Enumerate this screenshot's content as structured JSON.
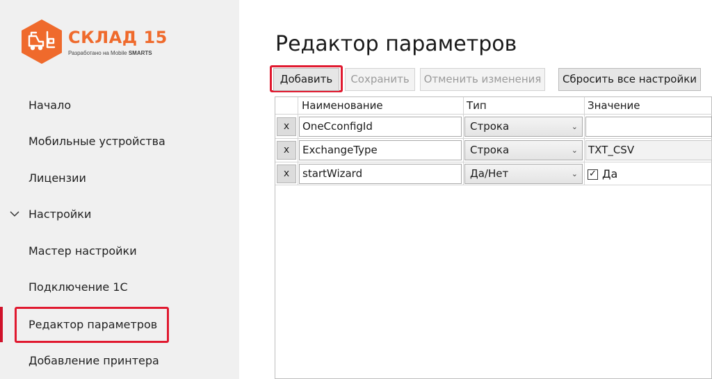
{
  "brand": {
    "title": "СКЛАД 15",
    "subtitle_prefix": "Разработано на Mobile ",
    "subtitle_bold": "SMARTS",
    "accent": "#ef6a2c"
  },
  "sidebar": {
    "items": [
      {
        "label": "Начало"
      },
      {
        "label": "Мобильные устройства"
      },
      {
        "label": "Лицензии"
      },
      {
        "label": "Настройки",
        "expanded": true
      },
      {
        "label": "Мастер настройки"
      },
      {
        "label": "Подключение 1С"
      },
      {
        "label": "Редактор параметров",
        "active": true
      },
      {
        "label": "Добавление принтера"
      }
    ]
  },
  "main": {
    "title": "Редактор параметров",
    "toolbar": {
      "add": "Добавить",
      "save": "Сохранить",
      "cancel": "Отменить изменения",
      "reset": "Сбросить все настройки"
    },
    "grid": {
      "columns": [
        "Наименование",
        "Тип",
        "Значение"
      ],
      "delete_label": "x",
      "rows": [
        {
          "name": "OneCconfigId",
          "type": "Строка",
          "value": ""
        },
        {
          "name": "ExchangeType",
          "type": "Строка",
          "value": "TXT_CSV"
        },
        {
          "name": "startWizard",
          "type": "Да/Нет",
          "value": "Да",
          "checked": true
        }
      ]
    }
  },
  "icons": {
    "chevron": "chevron-down-icon",
    "dropdown": "dropdown-arrow-icon",
    "logo": "forklift-logo-icon"
  },
  "colors": {
    "highlight": "#e0192f",
    "active_bar": "#d0122a",
    "sidebar_bg": "#f0f0f0"
  }
}
